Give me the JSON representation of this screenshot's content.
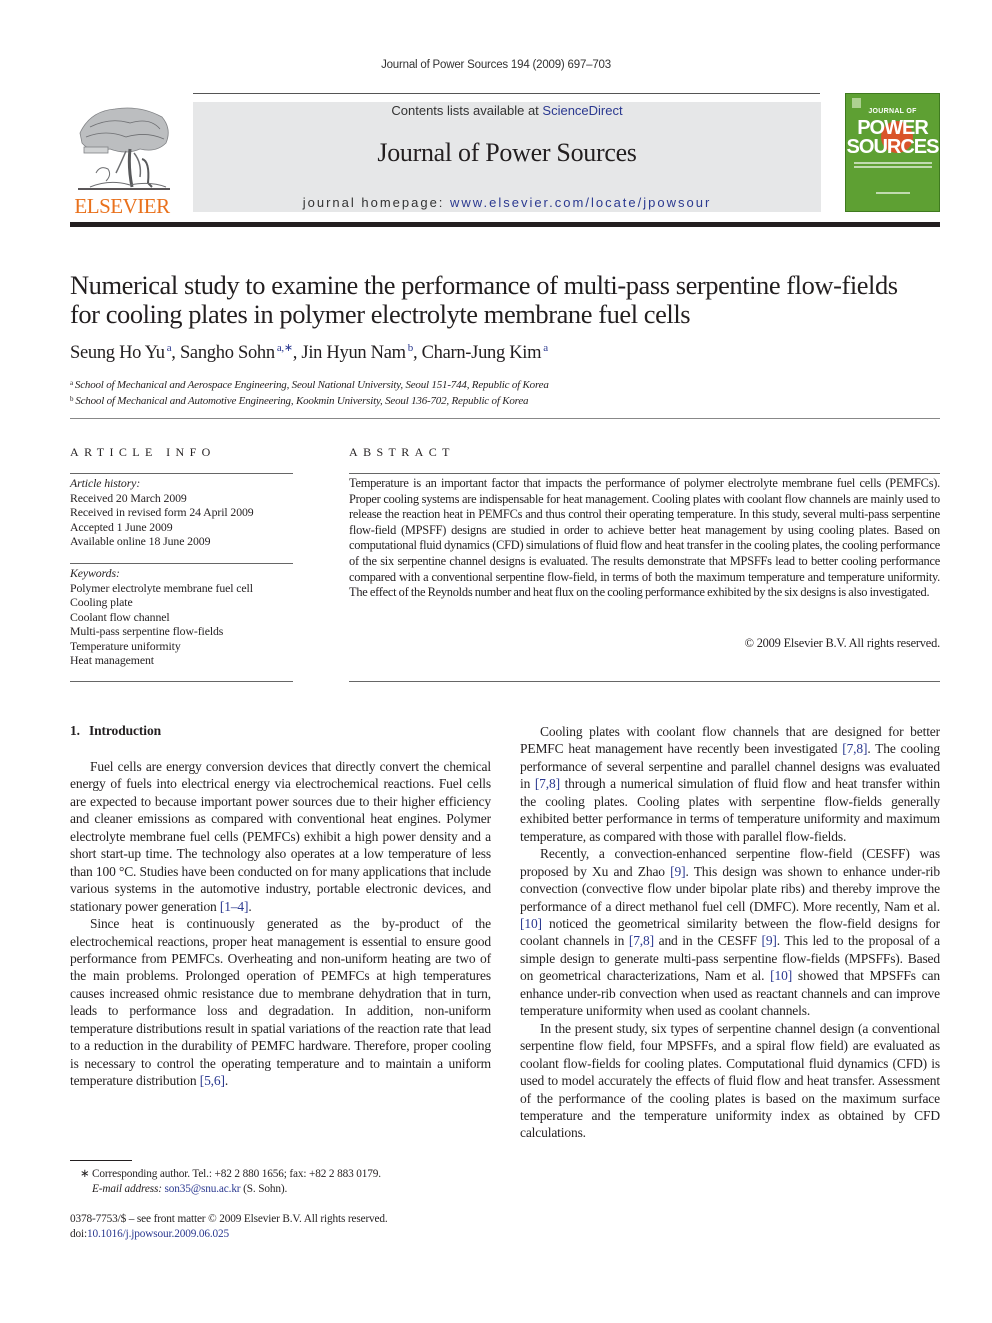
{
  "running_head": "Journal of Power Sources 194 (2009) 697–703",
  "masthead": {
    "publisher_logo_text": "ELSEVIER",
    "contents_prefix": "Contents lists available at ",
    "contents_link": "ScienceDirect",
    "journal_title": "Journal of Power Sources",
    "homepage_prefix": "journal homepage: ",
    "homepage_link": "www.elsevier.com/locate/jpowsour",
    "cover": {
      "line1": "JOURNAL OF",
      "line2": "POWER",
      "line3": "SOURCES",
      "color": "#5ea033",
      "accent": "#d9542a"
    },
    "publisher_color": "#e9711c",
    "link_color": "#2b3990"
  },
  "article": {
    "title": "Numerical study to examine the performance of multi-pass serpentine flow-fields for cooling plates in polymer electrolyte membrane fuel cells",
    "authors": [
      {
        "name": "Seung Ho Yu",
        "sup": "a"
      },
      {
        "name": "Sangho Sohn",
        "sup": "a,∗"
      },
      {
        "name": "Jin Hyun Nam",
        "sup": "b"
      },
      {
        "name": "Charn-Jung Kim",
        "sup": "a"
      }
    ],
    "affiliations": [
      {
        "mark": "a",
        "text": "School of Mechanical and Aerospace Engineering, Seoul National University, Seoul 151-744, Republic of Korea"
      },
      {
        "mark": "b",
        "text": "School of Mechanical and Automotive Engineering, Kookmin University, Seoul 136-702, Republic of Korea"
      }
    ]
  },
  "article_info": {
    "heading": "ARTICLE INFO",
    "history_label": "Article history:",
    "history": [
      "Received 20 March 2009",
      "Received in revised form 24 April 2009",
      "Accepted 1 June 2009",
      "Available online 18 June 2009"
    ],
    "keywords_label": "Keywords:",
    "keywords": [
      "Polymer electrolyte membrane fuel cell",
      "Cooling plate",
      "Coolant flow channel",
      "Multi-pass serpentine flow-fields",
      "Temperature uniformity",
      "Heat management"
    ]
  },
  "abstract": {
    "heading": "ABSTRACT",
    "text": "Temperature is an important factor that impacts the performance of polymer electrolyte membrane fuel cells (PEMFCs). Proper cooling systems are indispensable for heat management. Cooling plates with coolant flow channels are mainly used to release the reaction heat in PEMFCs and thus control their operating temperature. In this study, several multi-pass serpentine flow-field (MPSFF) designs are studied in order to achieve better heat management by using cooling plates. Based on computational fluid dynamics (CFD) simulations of fluid flow and heat transfer in the cooling plates, the cooling performance of the six serpentine channel designs is evaluated. The results demonstrate that MPSFFs lead to better cooling performance compared with a conventional serpentine flow-field, in terms of both the maximum temperature and temperature uniformity. The effect of the Reynolds number and heat flux on the cooling performance exhibited by the six designs is also investigated.",
    "copyright": "© 2009 Elsevier B.V. All rights reserved."
  },
  "section": {
    "number": "1.",
    "title": "Introduction"
  },
  "body_left": [
    [
      {
        "t": "Fuel cells are energy conversion devices that directly convert the chemical energy of fuels into electrical energy via electrochemical reactions. Fuel cells are expected to because important power sources due to their higher efficiency and cleaner emissions as compared with conventional heat engines. Polymer electrolyte membrane fuel cells (PEMFCs) exhibit a high power density and a short start-up time. The technology also operates at a low temperature of less than 100 °C. Studies have been conducted on for many applications that include various systems in the automotive industry, portable electronic devices, and stationary power generation "
      },
      {
        "ref": "[1–4]"
      },
      {
        "t": "."
      }
    ],
    [
      {
        "t": "Since heat is continuously generated as the by-product of the electrochemical reactions, proper heat management is essential to ensure good performance from PEMFCs. Overheating and non-uniform heating are two of the main problems. Prolonged operation of PEMFCs at high temperatures causes increased ohmic resistance due to membrane dehydration that in turn, leads to performance loss and degradation. In addition, non-uniform temperature distributions result in spatial variations of the reaction rate that lead to a reduction in the durability of PEMFC hardware. Therefore, proper cooling is necessary to control the operating temperature and to maintain a uniform temperature distribution "
      },
      {
        "ref": "[5,6]"
      },
      {
        "t": "."
      }
    ]
  ],
  "body_right": [
    [
      {
        "t": "Cooling plates with coolant flow channels that are designed for better PEMFC heat management have recently been investigated "
      },
      {
        "ref": "[7,8]"
      },
      {
        "t": ". The cooling performance of several serpentine and parallel channel designs was evaluated in "
      },
      {
        "ref": "[7,8]"
      },
      {
        "t": " through a numerical simulation of fluid flow and heat transfer within the cooling plates. Cooling plates with serpentine flow-fields generally exhibited better performance in terms of temperature uniformity and maximum temperature, as compared with those with parallel flow-fields."
      }
    ],
    [
      {
        "t": "Recently, a convection-enhanced serpentine flow-field (CESFF) was proposed by Xu and Zhao "
      },
      {
        "ref": "[9]"
      },
      {
        "t": ". This design was shown to enhance under-rib convection (convective flow under bipolar plate ribs) and thereby improve the performance of a direct methanol fuel cell (DMFC). More recently, Nam et al. "
      },
      {
        "ref": "[10]"
      },
      {
        "t": " noticed the geometrical similarity between the flow-field designs for coolant channels in "
      },
      {
        "ref": "[7,8]"
      },
      {
        "t": " and in the CESFF "
      },
      {
        "ref": "[9]"
      },
      {
        "t": ". This led to the proposal of a simple design to generate multi-pass serpentine flow-fields (MPSFFs). Based on geometrical characterizations, Nam et al. "
      },
      {
        "ref": "[10]"
      },
      {
        "t": " showed that MPSFFs can enhance under-rib convection when used as reactant channels and can improve temperature uniformity when used as coolant channels."
      }
    ],
    [
      {
        "t": "In the present study, six types of serpentine channel design (a conventional serpentine flow field, four MPSFFs, and a spiral flow field) are evaluated as coolant flow-fields for cooling plates. Computational fluid dynamics (CFD) is used to model accurately the effects of fluid flow and heat transfer. Assessment of the performance of the cooling plates is based on the maximum surface temperature and the temperature uniformity index as obtained by CFD calculations."
      }
    ]
  ],
  "footnote": {
    "star": "∗",
    "text": "Corresponding author. Tel.: +82 2 880 1656; fax: +82 2 883 0179.",
    "email_label": "E-mail address:",
    "email": "son35@snu.ac.kr",
    "email_suffix": " (S. Sohn)."
  },
  "front_matter": {
    "issn_line": "0378-7753/$ – see front matter © 2009 Elsevier B.V. All rights reserved.",
    "doi_prefix": "doi:",
    "doi": "10.1016/j.jpowsour.2009.06.025"
  }
}
